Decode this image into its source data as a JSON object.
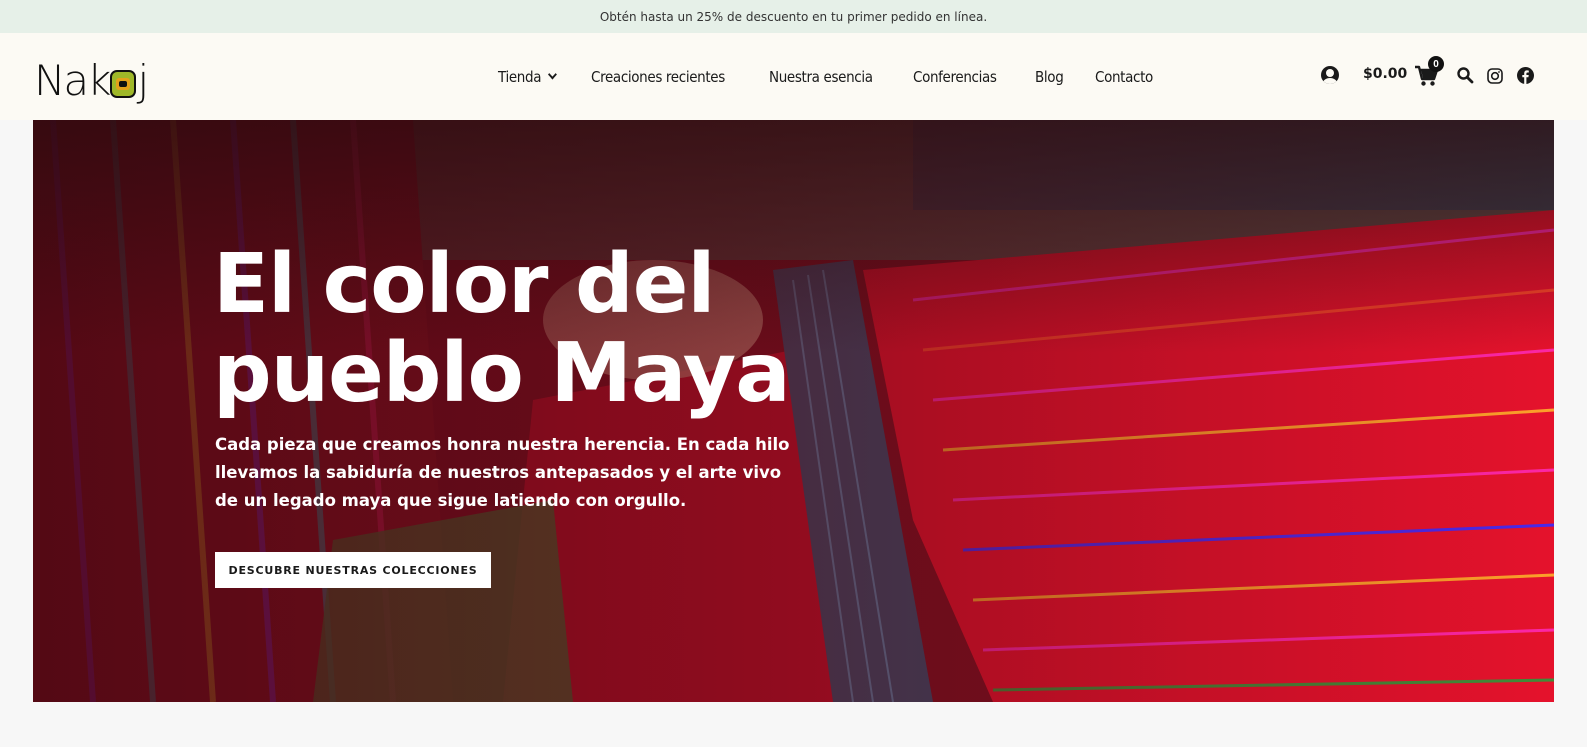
{
  "promo": {
    "text": "Obtén hasta un 25% de descuento en tu primer pedido en línea."
  },
  "brand": {
    "logo_prefix": "Nak",
    "logo_suffix": "j"
  },
  "nav": {
    "items": [
      {
        "label": "Tienda",
        "has_dropdown": true
      },
      {
        "label": "Creaciones recientes"
      },
      {
        "label": "Nuestra esencia"
      },
      {
        "label": "Conferencias"
      },
      {
        "label": "Blog"
      },
      {
        "label": "Contacto"
      }
    ]
  },
  "utils": {
    "cart_total": "$0.00",
    "cart_count": "0",
    "icons": [
      "account-icon",
      "cart-icon",
      "search-icon",
      "instagram-icon",
      "facebook-icon"
    ]
  },
  "hero": {
    "title_line1": "El color del",
    "title_line2": "pueblo Maya",
    "body": "Cada pieza que creamos honra nuestra herencia. En cada hilo llevamos la sabiduría de nuestros antepasados y el arte vivo de un legado maya que sigue latiendo con orgullo.",
    "cta_label": "DESCUBRE NUESTRAS COLECCIONES"
  },
  "colors": {
    "promo_bg": "#e6f0e8",
    "header_bg": "#fcfaf4",
    "hero_red": "#e0102a",
    "text_dark": "#1a1a1a"
  }
}
